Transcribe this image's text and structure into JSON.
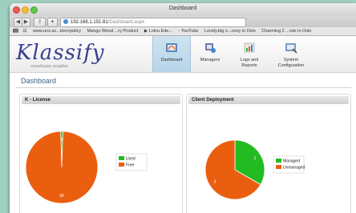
{
  "window": {
    "title": "Dashboard"
  },
  "browser": {
    "back_glyph": "◀",
    "forward_glyph": "▶",
    "share_glyph": "⇪",
    "add_tab_glyph": "+",
    "url_host": "192.168.1.151:81",
    "url_path": "/Dashboard.aspx",
    "bookmarks": [
      "www.uns.ac...tion+policy",
      "Mango Wood ...ry Product",
      "▶ Loinu Ede...",
      "- YouTube",
      "Lovely.big o...cony in Oxlo",
      "Charming 2 ...ndx in Oxlo"
    ]
  },
  "app": {
    "logo_text": "Klassify",
    "logo_tagline": "Classification simplified",
    "nav": [
      {
        "label": "Dashboard",
        "icon": "dashboard-icon",
        "active": true
      },
      {
        "label": "Managers",
        "icon": "managers-icon",
        "active": false
      },
      {
        "label": "Logs and Reports",
        "icon": "logs-icon",
        "active": false
      },
      {
        "label": "System Configuration",
        "icon": "config-icon",
        "active": false
      }
    ],
    "page_title": "Dashboard"
  },
  "panels": {
    "license_title": "K - License",
    "deploy_title": "Client Deployment"
  },
  "colors": {
    "used": "#22bb22",
    "free": "#ea5e0f",
    "managed": "#22bb22",
    "unmanaged": "#ea5e0f"
  },
  "chart_data": [
    {
      "type": "pie",
      "categories": [
        "Used",
        "Free"
      ],
      "values": [
        1,
        99
      ],
      "data_labels": [
        "1",
        "99"
      ],
      "legend_position": "right"
    },
    {
      "type": "pie",
      "categories": [
        "Managed",
        "Unmanaged"
      ],
      "values": [
        2,
        4
      ],
      "data_labels": [
        "2",
        "4"
      ],
      "legend_position": "right"
    }
  ]
}
